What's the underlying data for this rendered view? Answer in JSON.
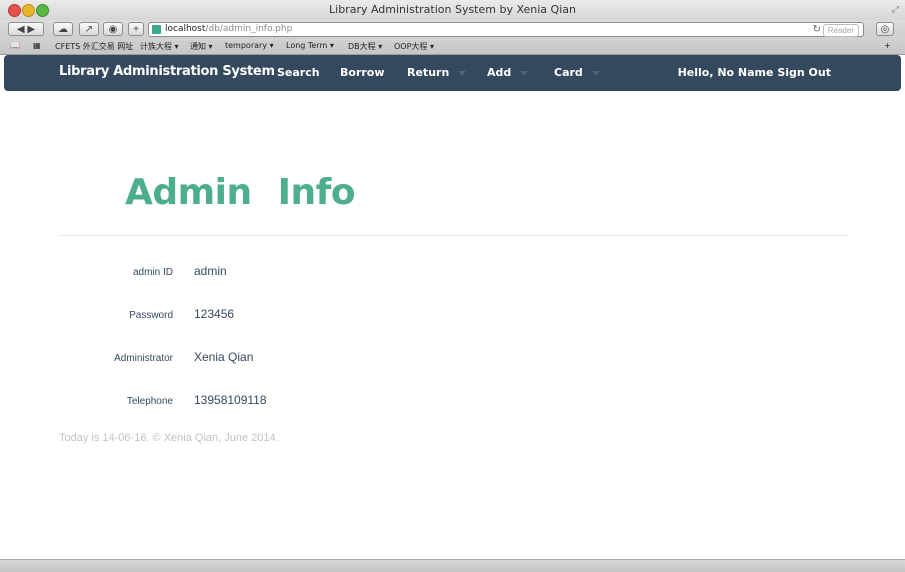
{
  "window": {
    "title": "Library Administration System by Xenia Qian"
  },
  "browser": {
    "url_host": "localhost",
    "url_path": "/db/admin_info.php",
    "reader_label": "Reader",
    "bookmarks": [
      "CFETS 外汇交易 网址",
      "计族大程 ▾",
      "通知 ▾",
      "temporary ▾",
      "Long Term ▾",
      "DB大程 ▾",
      "OOP大程 ▾"
    ]
  },
  "navbar": {
    "brand": "Library Administration System",
    "items": [
      {
        "label": "Search"
      },
      {
        "label": "Borrow"
      },
      {
        "label": "Return"
      },
      {
        "label": "Add"
      },
      {
        "label": "Card"
      }
    ],
    "greeting": "Hello, No Name",
    "sign_out": "Sign Out"
  },
  "page": {
    "heading": "Admin Info",
    "fields": [
      {
        "label": "admin ID",
        "value": "admin"
      },
      {
        "label": "Password",
        "value": "123456"
      },
      {
        "label": "Administrator",
        "value": "Xenia Qian"
      },
      {
        "label": "Telephone",
        "value": "13958109118"
      }
    ],
    "footer": "Today is 14-06-16.   © Xenia Qian, June 2014."
  },
  "colors": {
    "navbar": "#34495e",
    "accent": "#4cae8d",
    "text": "#34495e",
    "muted": "#bdc3c7"
  }
}
